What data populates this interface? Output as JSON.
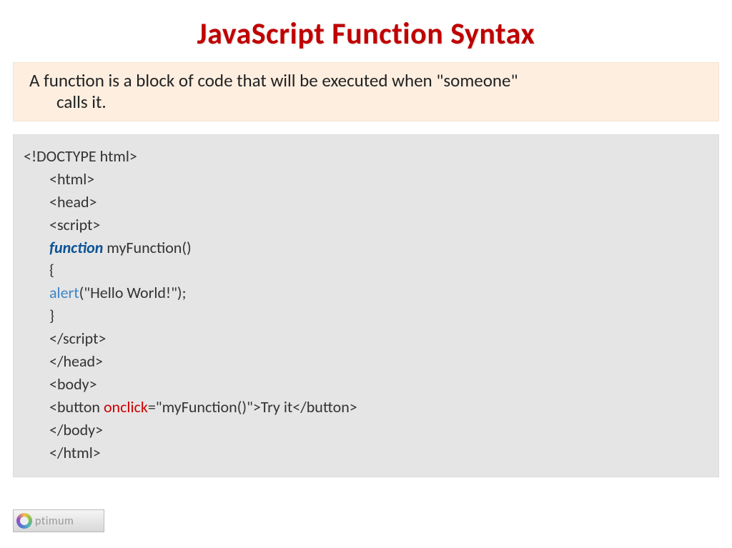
{
  "title": "JavaScript Function Syntax",
  "description_line1": "A function is a block of code that will be executed when \"someone\"",
  "description_line2": "calls it.",
  "code": {
    "l1": "<!DOCTYPE html>",
    "l2": "<html>",
    "l3": "<head>",
    "l4": "<script>",
    "l5a": "function",
    "l5b": " myFunction()",
    "l6": "{",
    "l7a": "alert",
    "l7b": "(\"Hello World!\");",
    "l8": "}",
    "l9": "</script>",
    "l10": "</head>",
    "l11": "<body>",
    "l12a": "<button ",
    "l12b": "onclick",
    "l12c": "=\"myFunction()\">Try it</button>",
    "l13": "</body>",
    "l14": "</html>"
  },
  "logo_text": "ptimum"
}
